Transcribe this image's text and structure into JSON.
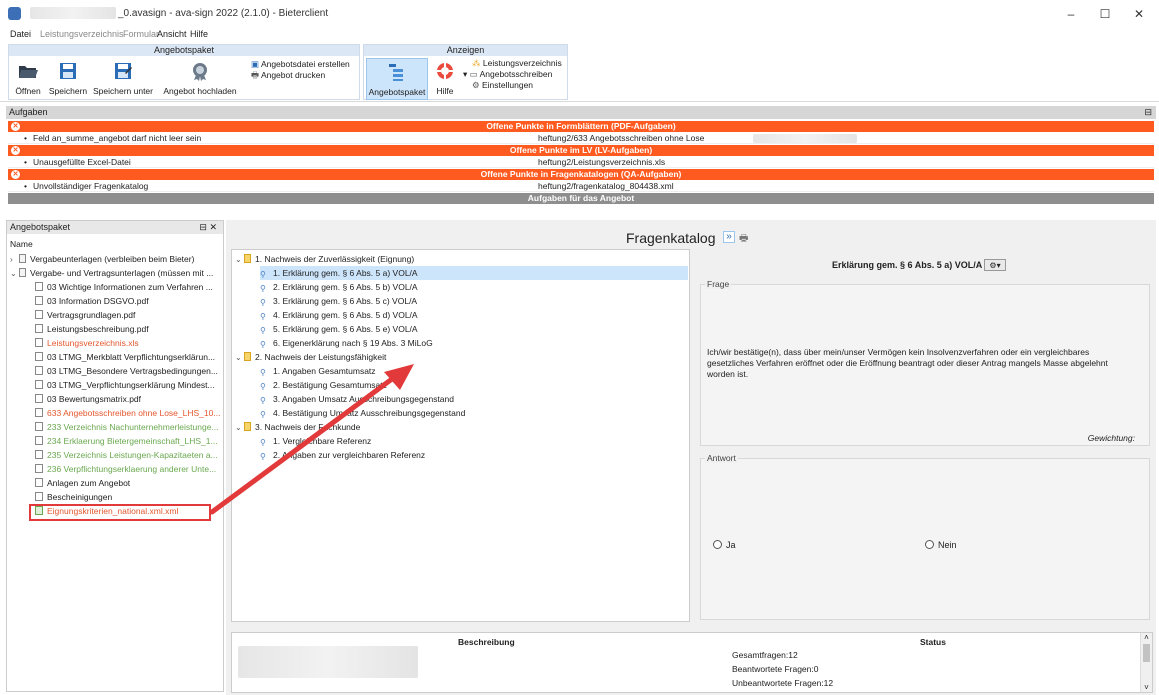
{
  "window": {
    "title": "_0.avasign - ava-sign 2022 (2.1.0) - Bieterclient",
    "min": "–",
    "max": "☐",
    "close": "✕"
  },
  "menu": [
    "Datei",
    "Leistungsverzeichnis",
    "Formular",
    "Ansicht",
    "Hilfe"
  ],
  "ribbon": {
    "group1_title": "Angebotspaket",
    "group2_title": "Anzeigen",
    "buttons": [
      "Öffnen",
      "Speichern",
      "Speichern unter",
      "Angebot hochladen"
    ],
    "create_file": "Angebotsdatei erstellen",
    "print_offer": "Angebot drucken",
    "view_buttons": [
      "Angebotspaket",
      "Hilfe"
    ],
    "view_links": [
      "Leistungsverzeichnis",
      "Angebotsschreiben",
      "Einstellungen"
    ]
  },
  "tasks": {
    "header": "Aufgaben",
    "pin": "⊟",
    "sections": [
      {
        "title": "Offene Punkte in Formblättern (PDF-Aufgaben)",
        "item": "Feld an_summe_angebot darf nicht leer sein",
        "path": "heftung2/633 Angebotsschreiben ohne Lose"
      },
      {
        "title": "Offene Punkte im LV (LV-Aufgaben)",
        "item": "Unausgefüllte Excel-Datei",
        "path": "heftung2/Leistungsverzeichnis.xls"
      },
      {
        "title": "Offene Punkte in Fragenkatalogen (QA-Aufgaben)",
        "item": "Unvollständiger Fragenkatalog",
        "path": "heftung2/fragenkatalog_804438.xml"
      }
    ],
    "footer": "Aufgaben für das Angebot"
  },
  "package": {
    "header": "Angebotspaket",
    "pin": "⊟ ✕",
    "col": "Name",
    "items": [
      {
        "label": "Vergabeunterlagen (verbleiben beim Bieter)",
        "color": "#222"
      },
      {
        "label": "Vergabe- und Vertragsunterlagen (müssen mit ...",
        "color": "#222"
      },
      {
        "label": "03 Wichtige Informationen zum Verfahren ...",
        "color": "#222"
      },
      {
        "label": "03 Information DSGVO.pdf",
        "color": "#222"
      },
      {
        "label": "Vertragsgrundlagen.pdf",
        "color": "#222"
      },
      {
        "label": "Leistungsbeschreibung.pdf",
        "color": "#222"
      },
      {
        "label": "Leistungsverzeichnis.xls",
        "color": "#e4572e"
      },
      {
        "label": "03 LTMG_Merkblatt Verpflichtungserklärun...",
        "color": "#222"
      },
      {
        "label": "03 LTMG_Besondere Vertragsbedingungen...",
        "color": "#222"
      },
      {
        "label": "03 LTMG_Verpflichtungserklärung Mindest...",
        "color": "#222"
      },
      {
        "label": "03 Bewertungsmatrix.pdf",
        "color": "#222"
      },
      {
        "label": "633 Angebotsschreiben ohne Lose_LHS_10...",
        "color": "#e4572e"
      },
      {
        "label": "233 Verzeichnis Nachunternehmerleistunge...",
        "color": "#6aa84f"
      },
      {
        "label": "234 Erklaerung Bietergemeinschaft_LHS_1...",
        "color": "#6aa84f"
      },
      {
        "label": "235 Verzeichnis Leistungen-Kapazitaeten a...",
        "color": "#6aa84f"
      },
      {
        "label": "236 Verpflichtungserklaerung anderer Unte...",
        "color": "#6aa84f"
      },
      {
        "label": "Anlagen zum Angebot",
        "color": "#222"
      },
      {
        "label": "Bescheinigungen",
        "color": "#222"
      },
      {
        "label": "Eignungskriterien_national.xml.xml",
        "color": "#e4572e"
      }
    ]
  },
  "catalog": {
    "title": "Fragenkatalog",
    "nav": "»",
    "print": "🖶",
    "groups": [
      {
        "label": "1. Nachweis der Zuverlässigkeit (Eignung)",
        "items": [
          "1. Erklärung gem. § 6 Abs. 5 a) VOL/A",
          "2. Erklärung gem. § 6 Abs. 5 b) VOL/A",
          "3. Erklärung gem. § 6 Abs. 5 c) VOL/A",
          "4. Erklärung gem. § 6 Abs. 5 d) VOL/A",
          "5. Erklärung gem. § 6 Abs. 5 e) VOL/A",
          "6. Eigenerklärung nach § 19 Abs. 3 MiLoG"
        ]
      },
      {
        "label": "2. Nachweis der Leistungsfähigkeit",
        "items": [
          "1. Angaben Gesamtumsatz",
          "2. Bestätigung Gesamtumsatz",
          "3. Angaben Umsatz Ausschreibungsgegenstand",
          "4. Bestätigung Umsatz Ausschreibungsgegenstand"
        ]
      },
      {
        "label": "3. Nachweis der Fachkunde",
        "items": [
          "1. Vergleichbare Referenz",
          "2. Angaben zur vergleichbaren Referenz"
        ]
      }
    ]
  },
  "question": {
    "heading": "Erklärung gem. § 6 Abs. 5 a) VOL/A",
    "frage_label": "Frage",
    "text": "Ich/wir bestätige(n), dass über mein/unser Vermögen kein Insolvenzverfahren oder ein vergleichbares gesetzliches Verfahren eröffnet oder die Eröffnung beantragt oder dieser Antrag mangels Masse abgelehnt worden ist.",
    "weight": "Gewichtung:",
    "antwort_label": "Antwort",
    "yes": "Ja",
    "no": "Nein"
  },
  "bottom": {
    "desc_head": "Beschreibung",
    "status_head": "Status",
    "status": [
      "Gesamtfragen:12",
      "Beantwortete Fragen:0",
      "Unbeantwortete Fragen:12"
    ]
  },
  "colors": {
    "accent_red": "#ff5a1f",
    "highlight": "#cde5fb",
    "arrow": "#e23a3a"
  }
}
